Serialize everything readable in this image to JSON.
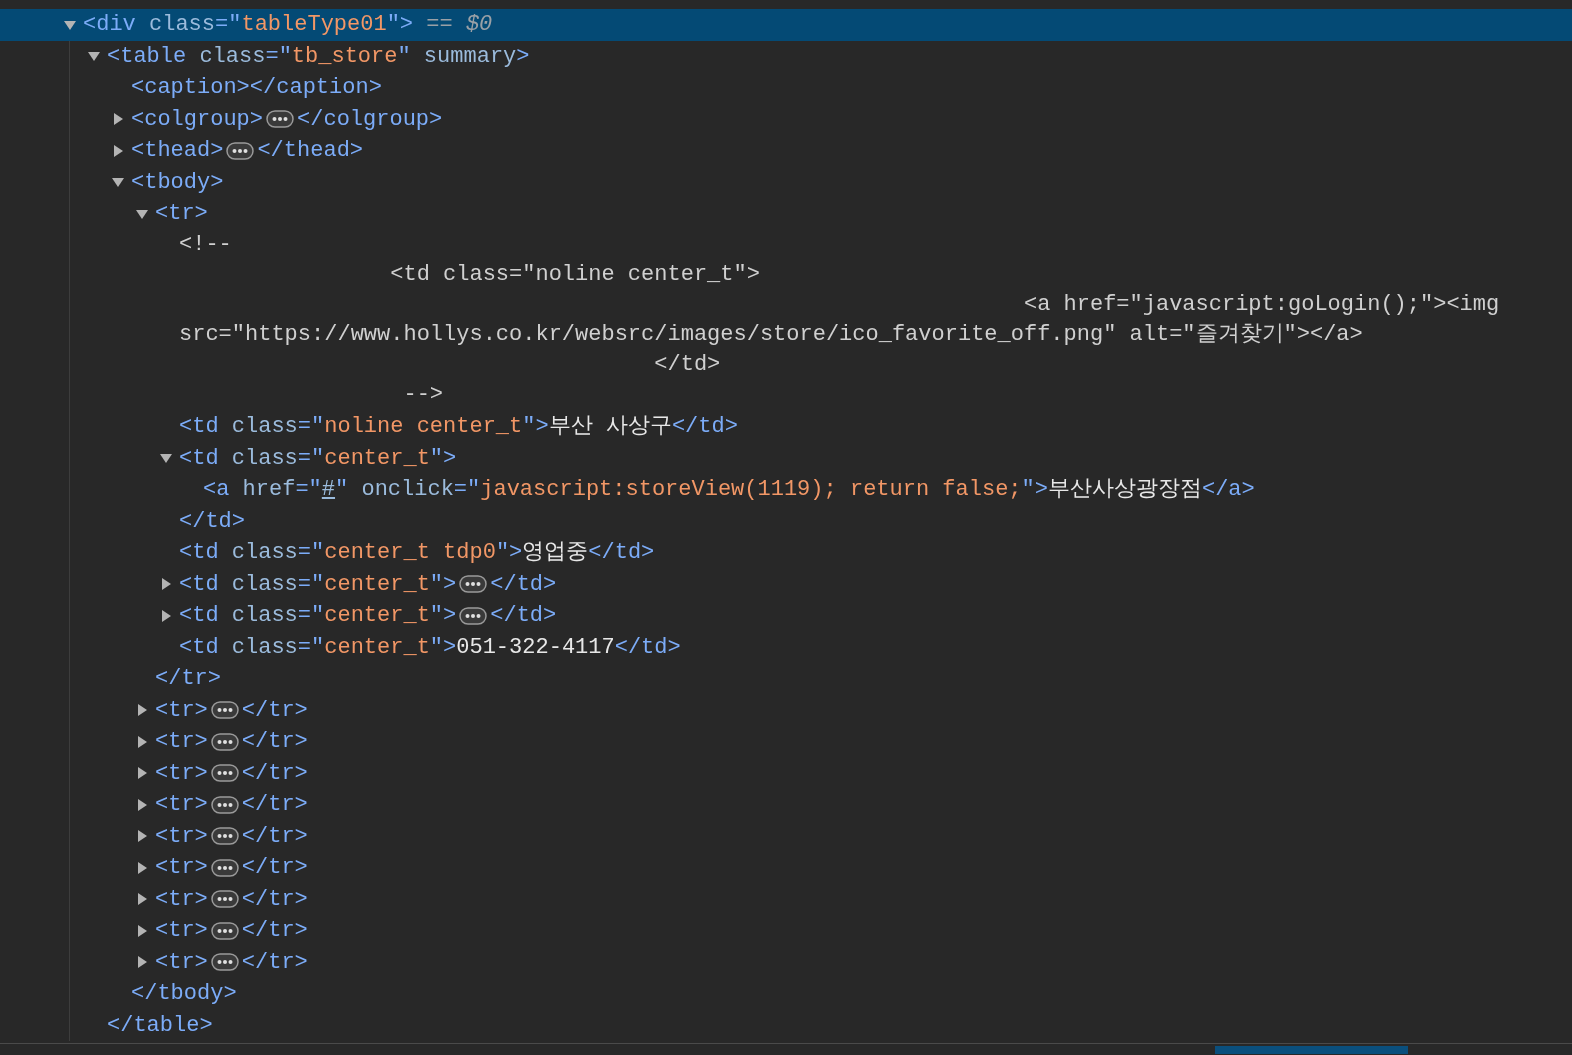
{
  "elements_tree": [
    {
      "kind": "element",
      "selected": true,
      "expanded": true,
      "tokens": [
        {
          "kind": "tag",
          "text": "<div"
        },
        {
          "kind": "attr",
          "text": " class"
        },
        {
          "kind": "punct",
          "text": "=\""
        },
        {
          "kind": "value",
          "text": "tableType01"
        },
        {
          "kind": "punct",
          "text": "\">"
        },
        {
          "kind": "ref",
          "text": " == "
        },
        {
          "kind": "refvar",
          "text": "$0"
        }
      ],
      "children": [
        {
          "kind": "element",
          "selected": false,
          "expanded": true,
          "tokens": [
            {
              "kind": "tag",
              "text": "<table"
            },
            {
              "kind": "attr",
              "text": " class"
            },
            {
              "kind": "punct",
              "text": "=\""
            },
            {
              "kind": "value",
              "text": "tb_store"
            },
            {
              "kind": "punct",
              "text": "\""
            },
            {
              "kind": "attr",
              "text": " summary"
            },
            {
              "kind": "tag",
              "text": ">"
            }
          ],
          "children": [
            {
              "kind": "element",
              "selected": false,
              "tokens": [
                {
                  "kind": "tag",
                  "text": "<caption></caption>"
                }
              ]
            },
            {
              "kind": "element",
              "selected": false,
              "expanded": false,
              "tokens": [
                {
                  "kind": "tag",
                  "text": "<colgroup>"
                }
              ],
              "close": [
                {
                  "kind": "tag",
                  "text": "</colgroup>"
                }
              ]
            },
            {
              "kind": "element",
              "selected": false,
              "expanded": false,
              "tokens": [
                {
                  "kind": "tag",
                  "text": "<thead>"
                }
              ],
              "close": [
                {
                  "kind": "tag",
                  "text": "</thead>"
                }
              ]
            },
            {
              "kind": "element",
              "selected": false,
              "expanded": true,
              "tokens": [
                {
                  "kind": "tag",
                  "text": "<tbody>"
                }
              ],
              "children": [
                {
                  "kind": "element",
                  "selected": false,
                  "expanded": true,
                  "tokens": [
                    {
                      "kind": "tag",
                      "text": "<tr>"
                    }
                  ],
                  "children": [
                    {
                      "kind": "comment",
                      "lines": [
                        "<!--",
                        "                <td class=\"noline center_t\">",
                        "                                                                <a href=\"javascript:goLogin();\"><img",
                        "src=\"https://www.hollys.co.kr/websrc/images/store/ico_favorite_off.png\" alt=\"즐겨찾기\"></a>",
                        "                                    </td>",
                        "                 -->"
                      ]
                    },
                    {
                      "kind": "element",
                      "selected": false,
                      "tokens": [
                        {
                          "kind": "tag",
                          "text": "<td"
                        },
                        {
                          "kind": "attr",
                          "text": " class"
                        },
                        {
                          "kind": "punct",
                          "text": "=\""
                        },
                        {
                          "kind": "value",
                          "text": "noline center_t"
                        },
                        {
                          "kind": "punct",
                          "text": "\">"
                        },
                        {
                          "kind": "text",
                          "text": "부산 사상구"
                        },
                        {
                          "kind": "tag",
                          "text": "</td>"
                        }
                      ]
                    },
                    {
                      "kind": "element",
                      "selected": false,
                      "expanded": true,
                      "tokens": [
                        {
                          "kind": "tag",
                          "text": "<td"
                        },
                        {
                          "kind": "attr",
                          "text": " class"
                        },
                        {
                          "kind": "punct",
                          "text": "=\""
                        },
                        {
                          "kind": "value",
                          "text": "center_t"
                        },
                        {
                          "kind": "punct",
                          "text": "\">"
                        }
                      ],
                      "children": [
                        {
                          "kind": "element",
                          "selected": false,
                          "tokens": [
                            {
                              "kind": "tag",
                              "text": "<a"
                            },
                            {
                              "kind": "attr",
                              "text": " href"
                            },
                            {
                              "kind": "punct",
                              "text": "=\""
                            },
                            {
                              "kind": "link",
                              "text": "#"
                            },
                            {
                              "kind": "punct",
                              "text": "\""
                            },
                            {
                              "kind": "attr",
                              "text": " onclick"
                            },
                            {
                              "kind": "punct",
                              "text": "=\""
                            },
                            {
                              "kind": "value",
                              "text": "javascript:storeView(1119); return false;"
                            },
                            {
                              "kind": "punct",
                              "text": "\">"
                            },
                            {
                              "kind": "text",
                              "text": "부산사상광장점"
                            },
                            {
                              "kind": "tag",
                              "text": "</a>"
                            }
                          ]
                        }
                      ],
                      "close": [
                        {
                          "kind": "tag",
                          "text": "</td>"
                        }
                      ]
                    },
                    {
                      "kind": "element",
                      "selected": false,
                      "tokens": [
                        {
                          "kind": "tag",
                          "text": "<td"
                        },
                        {
                          "kind": "attr",
                          "text": " class"
                        },
                        {
                          "kind": "punct",
                          "text": "=\""
                        },
                        {
                          "kind": "value",
                          "text": "center_t tdp0"
                        },
                        {
                          "kind": "punct",
                          "text": "\">"
                        },
                        {
                          "kind": "text",
                          "text": "영업중"
                        },
                        {
                          "kind": "tag",
                          "text": "</td>"
                        }
                      ]
                    },
                    {
                      "kind": "element",
                      "selected": false,
                      "expanded": false,
                      "tokens": [
                        {
                          "kind": "tag",
                          "text": "<td"
                        },
                        {
                          "kind": "attr",
                          "text": " class"
                        },
                        {
                          "kind": "punct",
                          "text": "=\""
                        },
                        {
                          "kind": "value",
                          "text": "center_t"
                        },
                        {
                          "kind": "punct",
                          "text": "\">"
                        }
                      ],
                      "close": [
                        {
                          "kind": "tag",
                          "text": "</td>"
                        }
                      ]
                    },
                    {
                      "kind": "element",
                      "selected": false,
                      "expanded": false,
                      "tokens": [
                        {
                          "kind": "tag",
                          "text": "<td"
                        },
                        {
                          "kind": "attr",
                          "text": " class"
                        },
                        {
                          "kind": "punct",
                          "text": "=\""
                        },
                        {
                          "kind": "value",
                          "text": "center_t"
                        },
                        {
                          "kind": "punct",
                          "text": "\">"
                        }
                      ],
                      "close": [
                        {
                          "kind": "tag",
                          "text": "</td>"
                        }
                      ]
                    },
                    {
                      "kind": "element",
                      "selected": false,
                      "tokens": [
                        {
                          "kind": "tag",
                          "text": "<td"
                        },
                        {
                          "kind": "attr",
                          "text": " class"
                        },
                        {
                          "kind": "punct",
                          "text": "=\""
                        },
                        {
                          "kind": "value",
                          "text": "center_t"
                        },
                        {
                          "kind": "punct",
                          "text": "\">"
                        },
                        {
                          "kind": "text",
                          "text": "051-322-4117"
                        },
                        {
                          "kind": "tag",
                          "text": "</td>"
                        }
                      ]
                    }
                  ],
                  "close": [
                    {
                      "kind": "tag",
                      "text": "</tr>"
                    }
                  ]
                },
                {
                  "kind": "element",
                  "selected": false,
                  "expanded": false,
                  "tokens": [
                    {
                      "kind": "tag",
                      "text": "<tr>"
                    }
                  ],
                  "close": [
                    {
                      "kind": "tag",
                      "text": "</tr>"
                    }
                  ]
                },
                {
                  "kind": "element",
                  "selected": false,
                  "expanded": false,
                  "tokens": [
                    {
                      "kind": "tag",
                      "text": "<tr>"
                    }
                  ],
                  "close": [
                    {
                      "kind": "tag",
                      "text": "</tr>"
                    }
                  ]
                },
                {
                  "kind": "element",
                  "selected": false,
                  "expanded": false,
                  "tokens": [
                    {
                      "kind": "tag",
                      "text": "<tr>"
                    }
                  ],
                  "close": [
                    {
                      "kind": "tag",
                      "text": "</tr>"
                    }
                  ]
                },
                {
                  "kind": "element",
                  "selected": false,
                  "expanded": false,
                  "tokens": [
                    {
                      "kind": "tag",
                      "text": "<tr>"
                    }
                  ],
                  "close": [
                    {
                      "kind": "tag",
                      "text": "</tr>"
                    }
                  ]
                },
                {
                  "kind": "element",
                  "selected": false,
                  "expanded": false,
                  "tokens": [
                    {
                      "kind": "tag",
                      "text": "<tr>"
                    }
                  ],
                  "close": [
                    {
                      "kind": "tag",
                      "text": "</tr>"
                    }
                  ]
                },
                {
                  "kind": "element",
                  "selected": false,
                  "expanded": false,
                  "tokens": [
                    {
                      "kind": "tag",
                      "text": "<tr>"
                    }
                  ],
                  "close": [
                    {
                      "kind": "tag",
                      "text": "</tr>"
                    }
                  ]
                },
                {
                  "kind": "element",
                  "selected": false,
                  "expanded": false,
                  "tokens": [
                    {
                      "kind": "tag",
                      "text": "<tr>"
                    }
                  ],
                  "close": [
                    {
                      "kind": "tag",
                      "text": "</tr>"
                    }
                  ]
                },
                {
                  "kind": "element",
                  "selected": false,
                  "expanded": false,
                  "tokens": [
                    {
                      "kind": "tag",
                      "text": "<tr>"
                    }
                  ],
                  "close": [
                    {
                      "kind": "tag",
                      "text": "</tr>"
                    }
                  ]
                },
                {
                  "kind": "element",
                  "selected": false,
                  "expanded": false,
                  "tokens": [
                    {
                      "kind": "tag",
                      "text": "<tr>"
                    }
                  ],
                  "close": [
                    {
                      "kind": "tag",
                      "text": "</tr>"
                    }
                  ]
                }
              ],
              "close": [
                {
                  "kind": "tag",
                  "text": "</tbody>"
                }
              ]
            }
          ],
          "close": [
            {
              "kind": "tag",
              "text": "</table>"
            }
          ]
        }
      ]
    }
  ]
}
